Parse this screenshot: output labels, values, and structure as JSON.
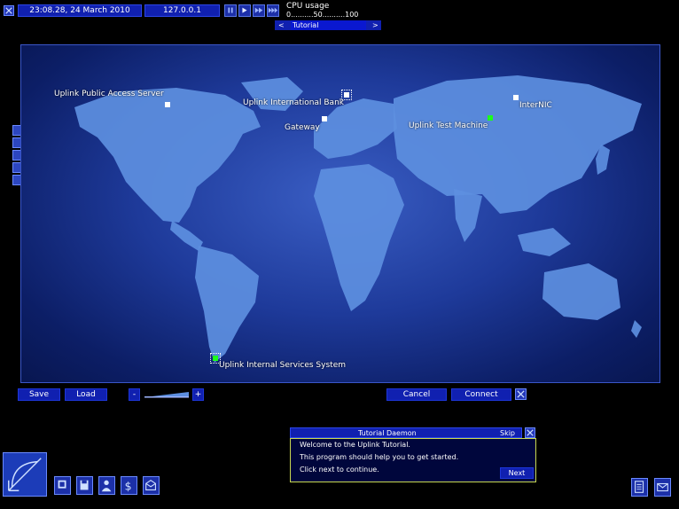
{
  "topbar": {
    "datetime": "23:08.28, 24 March 2010",
    "ip": "127.0.0.1",
    "cpu_label": "CPU usage",
    "cpu_scale": "0..........50..........100",
    "tutorial_prev": "<",
    "tutorial_name": "Tutorial",
    "tutorial_next": ">"
  },
  "map": {
    "nodes": [
      {
        "label": "Uplink Public Access Server"
      },
      {
        "label": "Uplink International Bank"
      },
      {
        "label": "InterNIC"
      },
      {
        "label": "Gateway"
      },
      {
        "label": "Uplink Test Machine"
      },
      {
        "label": "Uplink Internal Services System"
      }
    ]
  },
  "controls": {
    "save": "Save",
    "load": "Load",
    "zoom_out": "-",
    "zoom_in": "+",
    "cancel": "Cancel",
    "connect": "Connect"
  },
  "tutorial": {
    "title": "Tutorial Daemon",
    "skip": "Skip",
    "lines": [
      "Welcome to the Uplink Tutorial.",
      "This program should help you to get started.",
      "Click next to continue."
    ],
    "next": "Next"
  },
  "colors": {
    "panel_blue": "#1020b0",
    "map_land": "#5d8fe0",
    "node_active": "#1cff1c"
  },
  "icons": [
    "close-icon",
    "pause-icon",
    "play-icon",
    "fast-forward-icon",
    "fastest-forward-icon",
    "dish-icon",
    "computer-icon",
    "disk-icon",
    "people-icon",
    "finance-icon",
    "mail-icon",
    "notes-icon",
    "email-icon"
  ]
}
